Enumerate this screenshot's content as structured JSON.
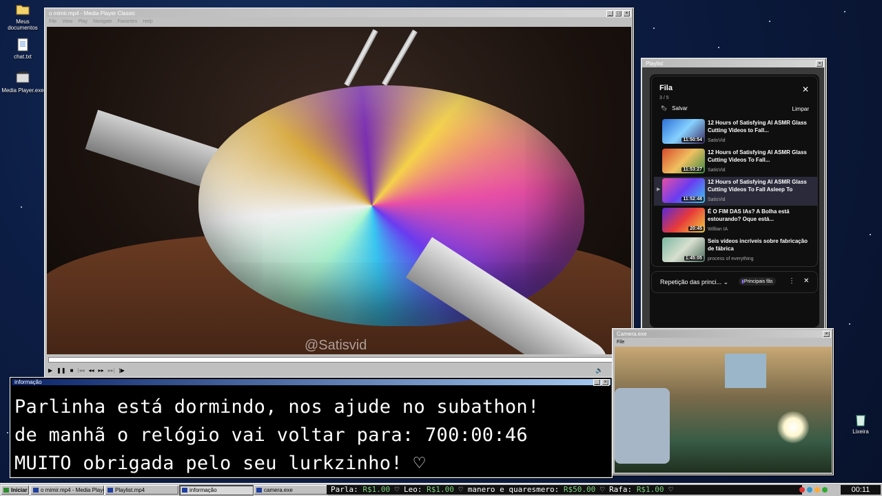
{
  "desktop": {
    "icons": [
      {
        "label": "Meus documentos",
        "icon": "folder-icon"
      },
      {
        "label": "chat.txt",
        "icon": "text-file-icon"
      },
      {
        "label": "Media Player.exe",
        "icon": "media-player-icon"
      },
      {
        "label": "Lixeira",
        "icon": "recycle-bin-icon"
      }
    ]
  },
  "media_player": {
    "title": "o mimir.mp4 - Media Player Classic",
    "menu": [
      "File",
      "View",
      "Play",
      "Navigate",
      "Favorites",
      "Help"
    ],
    "watermark": "@Satisvid",
    "controls": [
      "play-icon",
      "pause-icon",
      "stop-icon",
      "prev-icon",
      "rewind-icon",
      "forward-icon",
      "next-icon",
      "frame-step-icon"
    ]
  },
  "playlist": {
    "window_title": "Playlist",
    "title": "Fila",
    "count": "3 / 5",
    "save_label": "Salvar",
    "clear_label": "Limpar",
    "items": [
      {
        "title": "12 Hours of Satisfying AI ASMR Glass Cutting Videos to Fall...",
        "channel": "SatisVid",
        "duration": "11:50:54",
        "active": false
      },
      {
        "title": "12 Hours of Satisfying AI ASMR Glass Cutting Videos To Fall...",
        "channel": "SatisVid",
        "duration": "11:53:27",
        "active": false
      },
      {
        "title": "12 Hours of Satisfying AI ASMR Glass Cutting Videos To Fall Asleep To",
        "channel": "SatisVid",
        "duration": "11:52:48",
        "active": true
      },
      {
        "title": "É O FIM DAS IAs? A Bolha está estourando? Oque está...",
        "channel": "Willian IA",
        "duration": "20:45",
        "active": false
      },
      {
        "title": "Seis vídeos incríveis sobre fabricação de fábrica",
        "channel": "process of everything",
        "duration": "1:45:05",
        "active": false
      }
    ],
    "repeat_label": "Repetição das princi...",
    "badge_label": "Principais fãs"
  },
  "info_window": {
    "title": "informação",
    "lines": [
      "Parlinha está dormindo, nos ajude no subathon!",
      "de manhã o relógio vai voltar para:  700:00:46",
      "MUITO obrigada pelo seu lurkzinho! ♡"
    ]
  },
  "camera_window": {
    "title": "Camera.exe",
    "menu": "File"
  },
  "taskbar": {
    "start_label": "Iniciar",
    "buttons": [
      "o mimir.mp4 - Media Playe...",
      "Playlist.mp4",
      "informação",
      "camera.exe"
    ],
    "ticker": [
      {
        "name": "Parla:",
        "amount": "R$1.00"
      },
      {
        "name": "Leo:",
        "amount": "R$1.00"
      },
      {
        "name": "manero e quaresmero:",
        "amount": "R$50.00"
      },
      {
        "name": "Rafa:",
        "amount": "R$1.00"
      }
    ],
    "clock": "00:11"
  }
}
